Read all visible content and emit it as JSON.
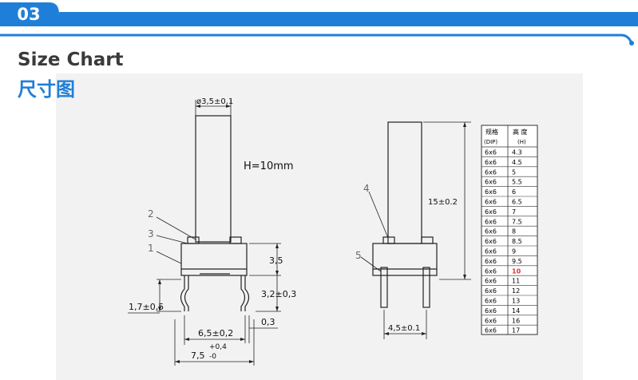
{
  "header": {
    "section_number": "03",
    "title_en": "Size Chart",
    "title_cn": "尺寸图",
    "accent_color": "#1f7fd8"
  },
  "front_view": {
    "dim_top_diameter": "ø3,5±0,1",
    "height_note": "H=10mm",
    "part_labels": [
      "2",
      "3",
      "1"
    ],
    "dim_body_height": "3,5",
    "dim_leg_height": "3,2±0,3",
    "dim_leg_offset": "1,7±0,5",
    "dim_leg_thickness": "0,3",
    "dim_pin_span": "6,5±0,2",
    "dim_overall_base": "7,5",
    "dim_overall_tol_plus": "+0,4",
    "dim_overall_tol_minus": "-0"
  },
  "side_view": {
    "part_labels": [
      "4",
      "5"
    ],
    "dim_total_height": "15±0.2",
    "dim_pin_spacing": "4,5±0.1"
  },
  "size_table": {
    "header_col1_line1": "规格",
    "header_col1_line2": "(DIP)",
    "header_col2_line1": "高  度",
    "header_col2_line2": "(H)",
    "highlight_color": "#e03030",
    "rows": [
      {
        "spec": "6x6",
        "height": "4.3",
        "highlight": false
      },
      {
        "spec": "6x6",
        "height": "4.5",
        "highlight": false
      },
      {
        "spec": "6x6",
        "height": "5",
        "highlight": false
      },
      {
        "spec": "6x6",
        "height": "5.5",
        "highlight": false
      },
      {
        "spec": "6x6",
        "height": "6",
        "highlight": false
      },
      {
        "spec": "6x6",
        "height": "6.5",
        "highlight": false
      },
      {
        "spec": "6x6",
        "height": "7",
        "highlight": false
      },
      {
        "spec": "6x6",
        "height": "7.5",
        "highlight": false
      },
      {
        "spec": "6x6",
        "height": "8",
        "highlight": false
      },
      {
        "spec": "6x6",
        "height": "8.5",
        "highlight": false
      },
      {
        "spec": "6x6",
        "height": "9",
        "highlight": false
      },
      {
        "spec": "6x6",
        "height": "9.5",
        "highlight": false
      },
      {
        "spec": "6x6",
        "height": "10",
        "highlight": true
      },
      {
        "spec": "6x6",
        "height": "11",
        "highlight": false
      },
      {
        "spec": "6x6",
        "height": "12",
        "highlight": false
      },
      {
        "spec": "6x6",
        "height": "13",
        "highlight": false
      },
      {
        "spec": "6x6",
        "height": "14",
        "highlight": false
      },
      {
        "spec": "6x6",
        "height": "16",
        "highlight": false
      },
      {
        "spec": "6x6",
        "height": "17",
        "highlight": false
      }
    ]
  }
}
